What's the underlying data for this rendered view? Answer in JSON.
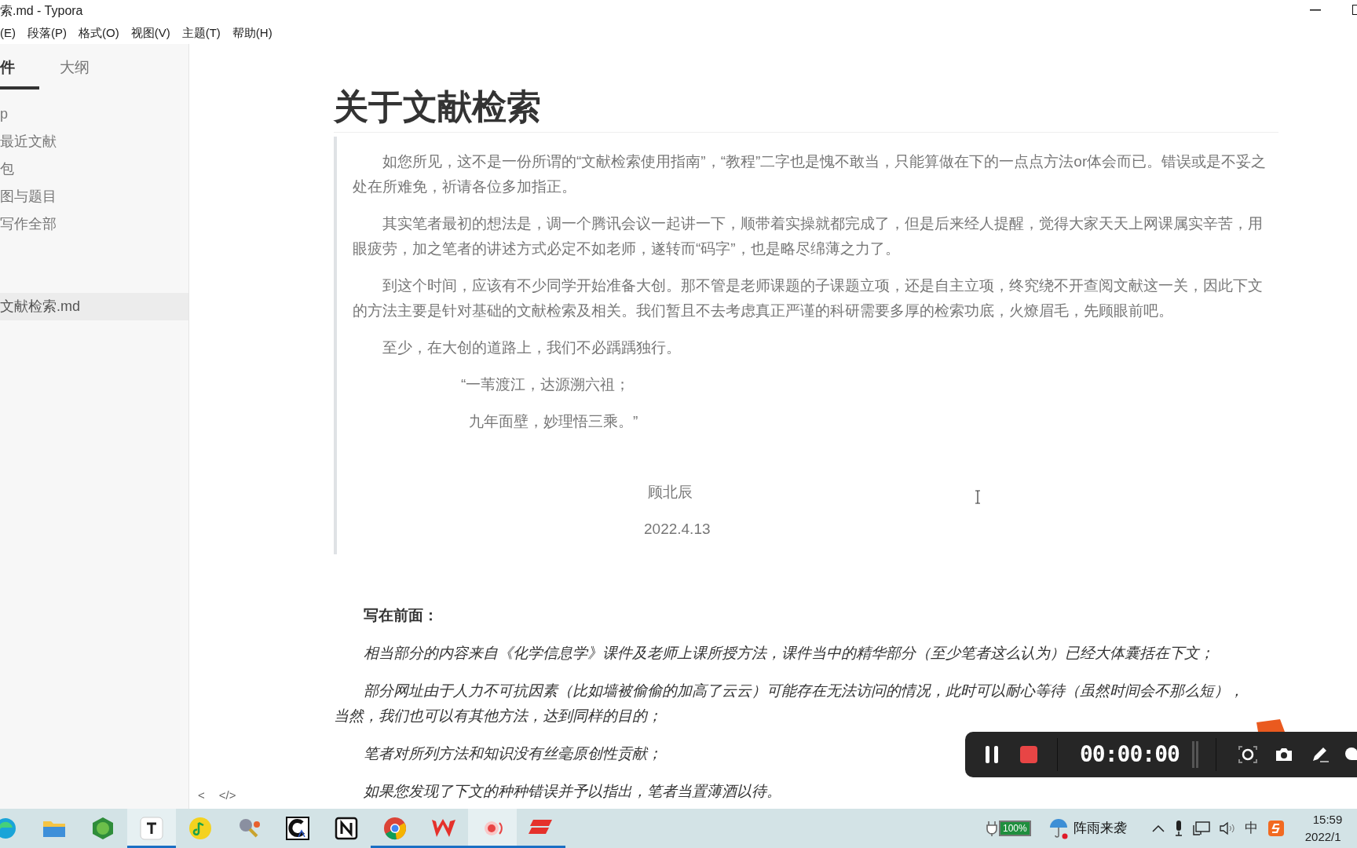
{
  "window": {
    "title": "索.md - Typora"
  },
  "menu": [
    "(E)",
    "段落(P)",
    "格式(O)",
    "视图(V)",
    "主题(T)",
    "帮助(H)"
  ],
  "sidebar": {
    "tabs": [
      {
        "label": "件",
        "selected": true
      },
      {
        "label": "大纲",
        "selected": false
      }
    ],
    "items": [
      {
        "label": "p",
        "selected": false
      },
      {
        "label": "最近文献",
        "selected": false
      },
      {
        "label": "包",
        "selected": false
      },
      {
        "label": "图与题目",
        "selected": false
      },
      {
        "label": "写作全部",
        "selected": false
      },
      {
        "label": "文献检索.md",
        "selected": true
      }
    ],
    "footer": [
      "<",
      "</>"
    ]
  },
  "document": {
    "heading": "关于文献检索",
    "quote": [
      {
        "kind": "para",
        "text": "如您所见，这不是一份所谓的“文献检索使用指南”，“教程”二字也是愧不敢当，只能算做在下的一点点方法or体会而已。错误或是不妥之处在所难免，祈请各位多加指正。"
      },
      {
        "kind": "para",
        "text": "其实笔者最初的想法是，调一个腾讯会议一起讲一下，顺带着实操就都完成了，但是后来经人提醒，觉得大家天天上网课属实辛苦，用眼疲劳，加之笔者的讲述方式必定不如老师，遂转而“码字”，也是略尽绵薄之力了。"
      },
      {
        "kind": "para",
        "text": "到这个时间，应该有不少同学开始准备大创。那不管是老师课题的子课题立项，还是自主立项，终究绕不开查阅文献这一关，因此下文的方法主要是针对基础的文献检索及相关。我们暂且不去考虑真正严谨的科研需要多厚的检索功底，火燎眉毛，先顾眼前吧。"
      },
      {
        "kind": "para",
        "text": "至少，在大创的道路上，我们不必踽踽独行。"
      },
      {
        "kind": "verse",
        "text": "“一苇渡江，达源溯六祖；"
      },
      {
        "kind": "verse",
        "text": "九年面壁，妙理悟三乘。”"
      },
      {
        "kind": "signature",
        "text": "顾北辰"
      },
      {
        "kind": "date",
        "text": "2022.4.13"
      }
    ],
    "preface_title": "写在前面：",
    "preface": [
      "相当部分的内容来自《化学信息学》课件及老师上课所授方法，课件当中的精华部分（至少笔者这么认为）已经大体囊括在下文；",
      "部分网址由于人力不可抗因素（比如墙被偷偷的加高了云云）可能存在无法访问的情况，此时可以耐心等待（虽然时间会不那么短），当然，我们也可以有其他方法，达到同样的目的；",
      "笔者对所列方法和知识没有丝毫原创性贡献；",
      "如果您发现了下文的种种错误并予以指出，笔者当置薄酒以待。"
    ]
  },
  "recorder": {
    "timer": "00:00:00"
  },
  "taskbar": {
    "apps": [
      {
        "kind": "edge",
        "running": false,
        "selected": false
      },
      {
        "kind": "folder",
        "running": false,
        "selected": false
      },
      {
        "kind": "cd",
        "running": false,
        "selected": false
      },
      {
        "kind": "typora",
        "running": true,
        "selected": true
      },
      {
        "kind": "music",
        "running": false,
        "selected": false
      },
      {
        "kind": "molecule",
        "running": false,
        "selected": false
      },
      {
        "kind": "g",
        "running": false,
        "selected": false
      },
      {
        "kind": "notion",
        "running": false,
        "selected": false
      },
      {
        "kind": "chrome",
        "running": true,
        "selected": false
      },
      {
        "kind": "wps",
        "running": true,
        "selected": false
      },
      {
        "kind": "recorder",
        "running": true,
        "selected": true
      },
      {
        "kind": "red",
        "running": true,
        "selected": false
      }
    ],
    "battery": "100%",
    "weather": "阵雨来袭",
    "ime": "中",
    "time": "15:59",
    "date": "2022/1"
  }
}
